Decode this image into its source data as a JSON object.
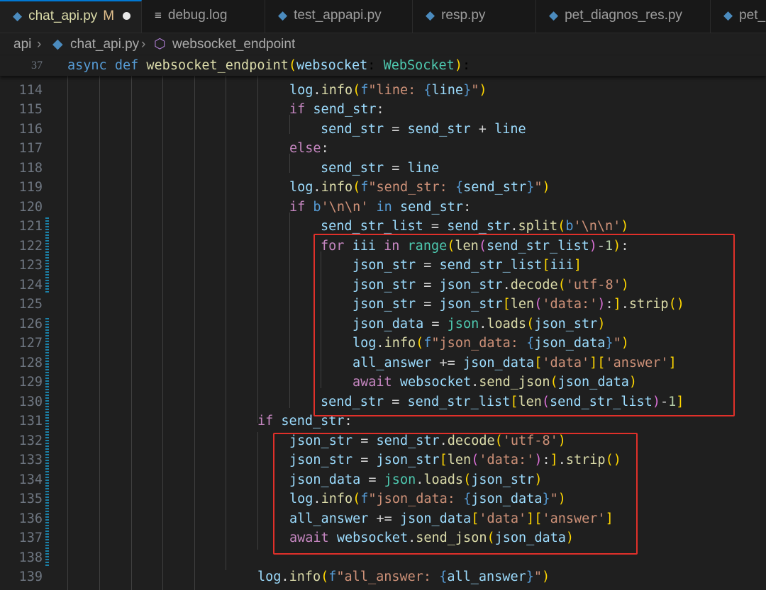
{
  "tabs": [
    {
      "label": "chat_api.py",
      "status": "M",
      "icon": "python-icon",
      "active": true,
      "unsaved": true
    },
    {
      "label": "debug.log",
      "icon": "file-lines-icon"
    },
    {
      "label": "test_appapi.py",
      "icon": "python-icon"
    },
    {
      "label": "resp.py",
      "icon": "python-icon"
    },
    {
      "label": "pet_diagnos_res.py",
      "icon": "python-icon"
    },
    {
      "label": "pet_",
      "icon": "python-icon"
    }
  ],
  "breadcrumb": {
    "folder": "api",
    "file": "chat_api.py",
    "symbol": "websocket_endpoint"
  },
  "sticky_line": {
    "number": "37",
    "text": "async def websocket_endpoint(websocket: WebSocket):"
  },
  "lines": [
    {
      "n": "114",
      "text": "log.info(f\"line: {line}\")"
    },
    {
      "n": "115",
      "text": "if send_str:"
    },
    {
      "n": "116",
      "text": "send_str = send_str + line"
    },
    {
      "n": "117",
      "text": "else:"
    },
    {
      "n": "118",
      "text": "send_str = line"
    },
    {
      "n": "119",
      "text": "log.info(f\"send_str: {send_str}\")"
    },
    {
      "n": "120",
      "text": "if b'\\n\\n' in send_str:"
    },
    {
      "n": "121",
      "text": "send_str_list = send_str.split(b'\\n\\n')"
    },
    {
      "n": "122",
      "text": "for iii in range(len(send_str_list)-1):"
    },
    {
      "n": "123",
      "text": "json_str = send_str_list[iii]"
    },
    {
      "n": "124",
      "text": "json_str = json_str.decode('utf-8')"
    },
    {
      "n": "125",
      "text": "json_str = json_str[len('data:'):].strip()"
    },
    {
      "n": "126",
      "text": "json_data = json.loads(json_str)"
    },
    {
      "n": "127",
      "text": "log.info(f\"json_data: {json_data}\")"
    },
    {
      "n": "128",
      "text": "all_answer += json_data['data']['answer']"
    },
    {
      "n": "129",
      "text": "await websocket.send_json(json_data)"
    },
    {
      "n": "130",
      "text": "send_str = send_str_list[len(send_str_list)-1]"
    },
    {
      "n": "131",
      "text": "if send_str:"
    },
    {
      "n": "132",
      "text": "json_str = send_str.decode('utf-8')"
    },
    {
      "n": "133",
      "text": "json_str = json_str[len('data:'):].strip()"
    },
    {
      "n": "134",
      "text": "json_data = json.loads(json_str)"
    },
    {
      "n": "135",
      "text": "log.info(f\"json_data: {json_data}\")"
    },
    {
      "n": "136",
      "text": "all_answer += json_data['data']['answer']"
    },
    {
      "n": "137",
      "text": "await websocket.send_json(json_data)"
    },
    {
      "n": "138",
      "text": ""
    },
    {
      "n": "139",
      "text": "log.info(f\"all_answer: {all_answer}\")"
    }
  ],
  "colors": {
    "highlight_box": "#e0302a",
    "editor_bg": "#1f1f1f",
    "keyword": "#569cd6",
    "control": "#c586c0",
    "string": "#ce9178"
  }
}
